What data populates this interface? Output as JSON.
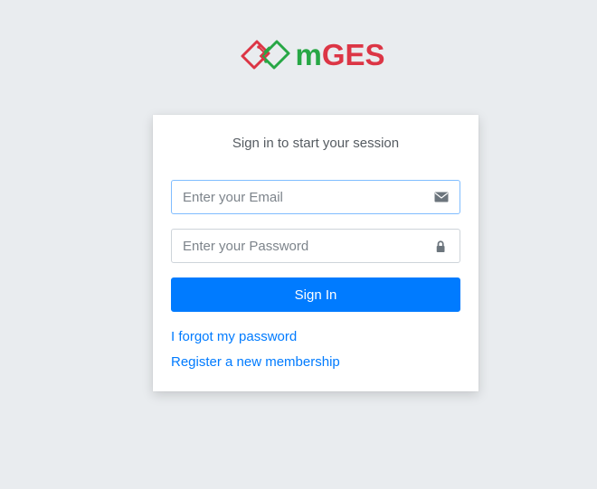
{
  "brand": {
    "prefix": "m",
    "suffix": "GES",
    "colors": {
      "green": "#27a745",
      "red": "#dc3545"
    }
  },
  "login": {
    "message": "Sign in to start your session",
    "email_placeholder": "Enter your Email",
    "password_placeholder": "Enter your Password",
    "email_icon": "envelope-icon",
    "password_icon": "lock-icon",
    "sign_in_label": "Sign In",
    "forgot_link": "I forgot my password",
    "register_link": "Register a new membership",
    "accent_color": "#007bff"
  }
}
